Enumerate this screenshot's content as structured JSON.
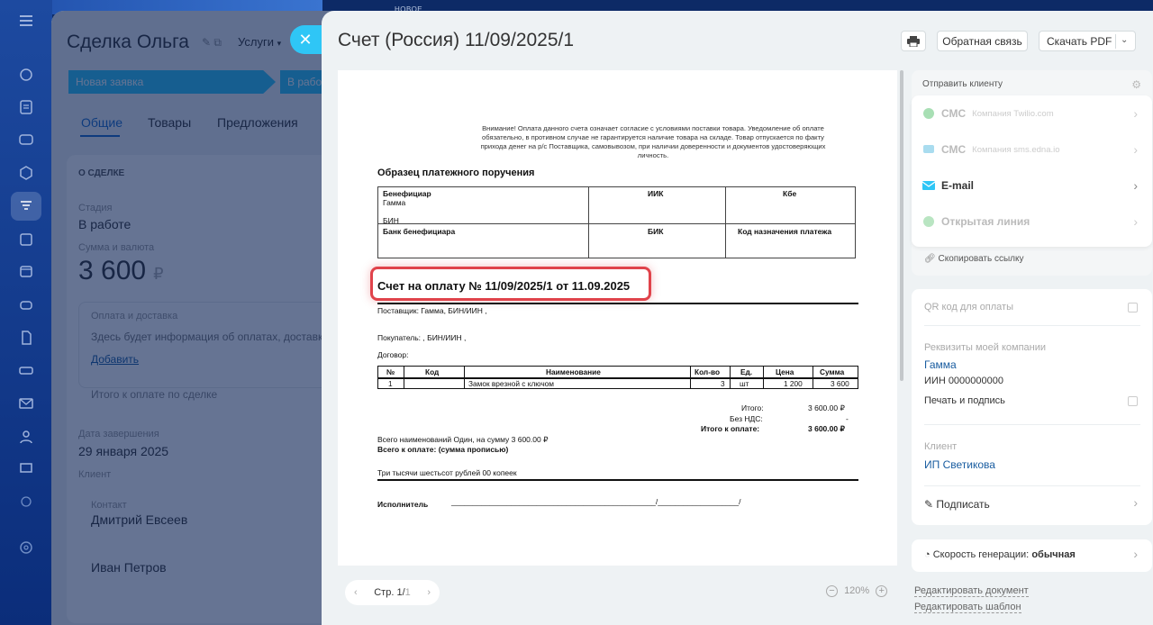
{
  "deal": {
    "title": "Сделка Ольга",
    "category": "Услуги",
    "stages": [
      "Новая заявка",
      "В работе"
    ],
    "tabs": [
      "Общие",
      "Товары",
      "Предложения"
    ],
    "section_title": "О СДЕЛКЕ",
    "stage_label": "Стадия",
    "stage_value": "В работе",
    "sum_label": "Сумма и валюта",
    "sum_value": "3 600",
    "currency": "₽",
    "payment_title": "Оплата и доставка",
    "payment_text": "Здесь будет информация об оплатах, доставках",
    "payment_add": "Добавить",
    "total_label": "Итого к оплате по сделке",
    "date_label": "Дата завершения",
    "date_value": "29 января 2025",
    "client_label": "Клиент",
    "contact_label": "Контакт",
    "contact_1": "Дмитрий Евсеев",
    "contact_2": "Иван Петров"
  },
  "new_tag": "НОВОЕ",
  "slider": {
    "title": "Счет (Россия) 11/09/2025/1",
    "feedback_label": "Обратная связь",
    "download_label": "Скачать PDF"
  },
  "document": {
    "warning": "Внимание! Оплата данного счета означает  согласие  с условиями  поставки товара. Уведомление об оплате обязательно,   в противном   случае не гарантируется наличие товара на складе. Товар отпускается по факту прихода денег на р/с Поставщика, самовывозом, при наличии доверенности и документов удостоверяющих личность.",
    "sample_title": "Образец платежного поручения",
    "bank": {
      "beneficiary": "Бенефициар",
      "beneficiary_name": "Гамма",
      "bin": "БИН",
      "iik": "ИИК",
      "kbe": "Кбе",
      "bank_beneficiary": "Банк бенефициара",
      "bik": "БИК",
      "purpose_code": "Код назначения платежа"
    },
    "invoice_title": "Счет на оплату № 11/09/2025/1  от 11.09.2025",
    "supplier": "Поставщик: Гамма, БИН/ИИН ,",
    "buyer": "Покупатель: , БИН/ИИН ,",
    "contract": "Договор:",
    "items_headers": [
      "№",
      "Код",
      "Наименование",
      "Кол-во",
      "Ед.",
      "Цена",
      "Сумма"
    ],
    "items": [
      {
        "n": "1",
        "code": "",
        "name": "Замок врезной с ключом",
        "qty": "3",
        "unit": "шт",
        "price": "1 200",
        "sum": "3 600"
      }
    ],
    "total_label": "Итого:",
    "total_value": "3 600.00 ₽",
    "vat_label": "Без НДС:",
    "vat_value": "-",
    "topay_label": "Итого к оплате:",
    "topay_value": "3 600.00 ₽",
    "count_line": "Всего наименований Один, на сумму 3 600.00 ₽",
    "words_label": "Всего к оплате: (сумма прописью)",
    "words": "Три тысячи шестьсот рублей 00 копеек",
    "executor_label": "Исполнитель",
    "executor_line": "________________________________________________/___________________/"
  },
  "pager": {
    "label": "Стр. 1/",
    "total": "1"
  },
  "zoom": {
    "value": "120%"
  },
  "links": {
    "edit_doc": "Редактировать документ",
    "edit_template": "Редактировать шаблон"
  },
  "send": {
    "title": "Отправить клиенту",
    "channels": [
      {
        "name": "СМС",
        "sub": "Компания Twilio.com",
        "icon": "whatsapp-icon",
        "enabled": false
      },
      {
        "name": "СМС",
        "sub": "Компания sms.edna.io",
        "icon": "chat-bubble-icon",
        "enabled": false
      },
      {
        "name": "E-mail",
        "sub": "",
        "icon": "envelope-icon",
        "enabled": true
      },
      {
        "name": "Открытая линия",
        "sub": "",
        "icon": "open-line-icon",
        "enabled": false
      }
    ],
    "copy_link": "Скопировать ссылку"
  },
  "details": {
    "qr_label": "QR код для оплаты",
    "company_label": "Реквизиты моей компании",
    "company_name": "Гамма",
    "company_inn": "ИИН 0000000000",
    "sign_stamp": "Печать и подпись",
    "client_label": "Клиент",
    "client_name": "ИП Светикова",
    "sign_label": "Подписать"
  },
  "speed": {
    "label": "Скорость генерации:",
    "value": "обычная"
  },
  "colors": {
    "accent": "#2fc6f6",
    "link": "#1a5da0",
    "highlight": "#e0434b"
  }
}
